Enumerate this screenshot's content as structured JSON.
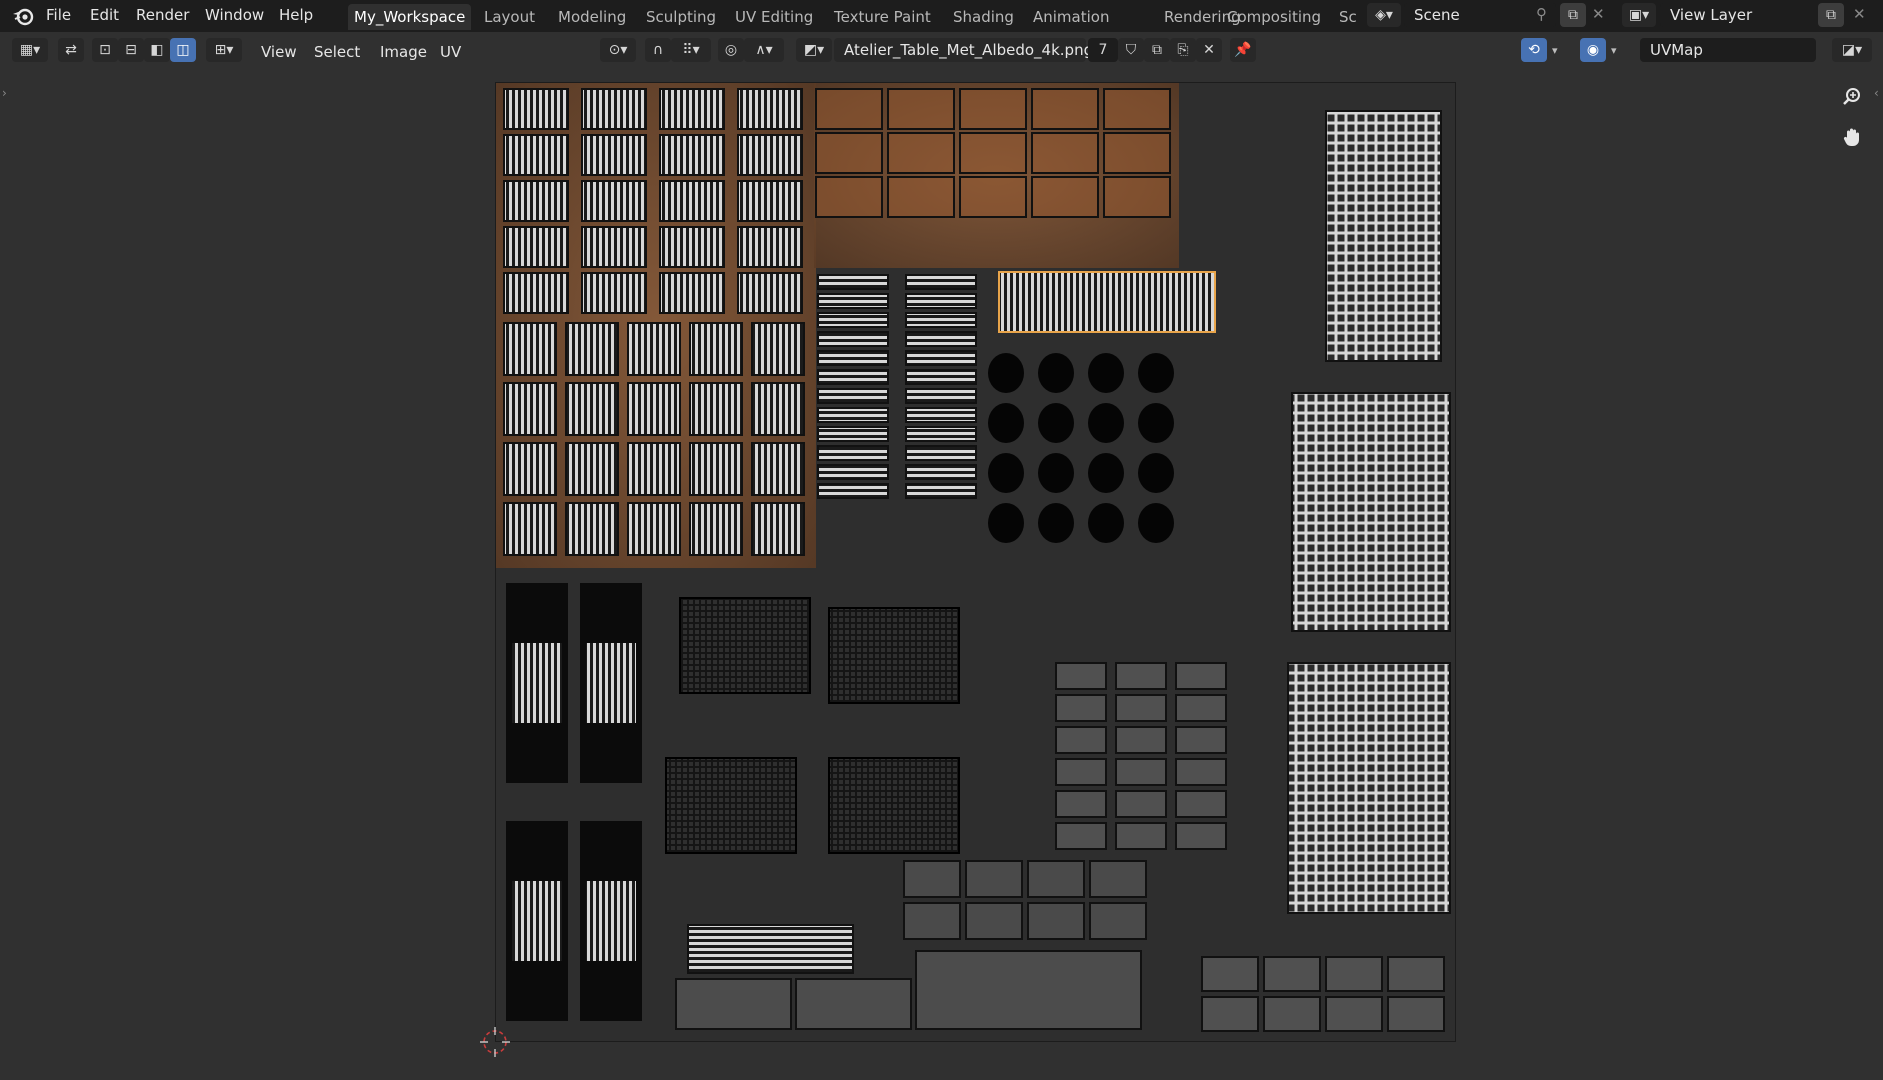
{
  "menubar": {
    "items": [
      "File",
      "Edit",
      "Render",
      "Window",
      "Help"
    ]
  },
  "workspaces": {
    "tabs": [
      "My_Workspace",
      "Layout",
      "Modeling",
      "Sculpting",
      "UV Editing",
      "Texture Paint",
      "Shading",
      "Animation",
      "Rendering",
      "Compositing",
      "Sc"
    ],
    "active": "My_Workspace"
  },
  "scene": {
    "name": "Scene"
  },
  "view_layer": {
    "name": "View Layer"
  },
  "header": {
    "menus": [
      "View",
      "Select",
      "Image",
      "UV"
    ],
    "image_name": "Atelier_Table_Met_Albedo_4k.png",
    "users_count": "7",
    "uv_map": "UVMap"
  },
  "colors": {
    "accent": "#4772b3",
    "background": "#303030",
    "topbar": "#1d1d1d",
    "rust": "#8a5a36",
    "highlight_island": "#e8a44a"
  },
  "icons": {
    "blender_logo": "blender-logo-icon",
    "editor_type": "uv-editor-icon",
    "zoom": "zoom-in-icon",
    "pan": "hand-pan-icon",
    "cursor": "2d-cursor-icon"
  }
}
